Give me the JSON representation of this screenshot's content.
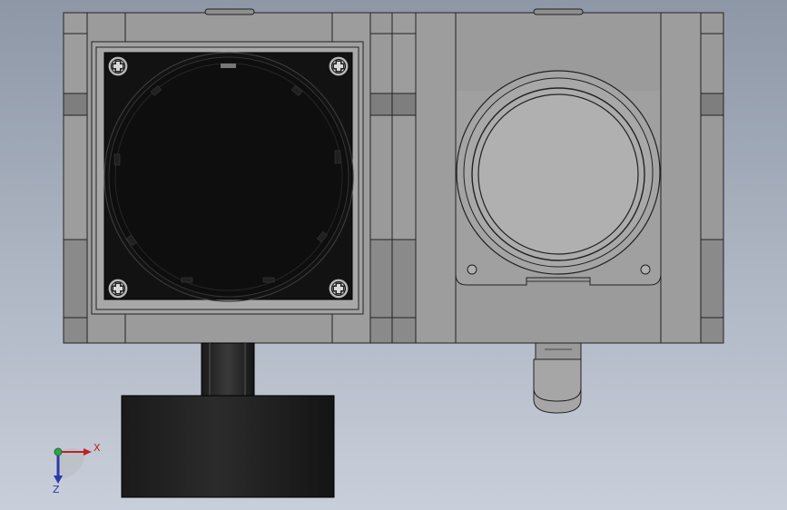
{
  "viewport": {
    "colors": {
      "background_top": "#8e97a6",
      "background_bottom": "#c9cfda",
      "part_fill": "#9b9b9b",
      "part_dark_band": "#7e7e7e",
      "edge": "#222222",
      "gauge_face": "#121212",
      "knob": "#1e1e1e",
      "axis_x": "#c0202a",
      "axis_y": "#2fa24a",
      "axis_z": "#2a3aa8"
    }
  },
  "triad": {
    "x_label": "X",
    "z_label": "Z",
    "icon": "coordinate-triad-icon"
  }
}
